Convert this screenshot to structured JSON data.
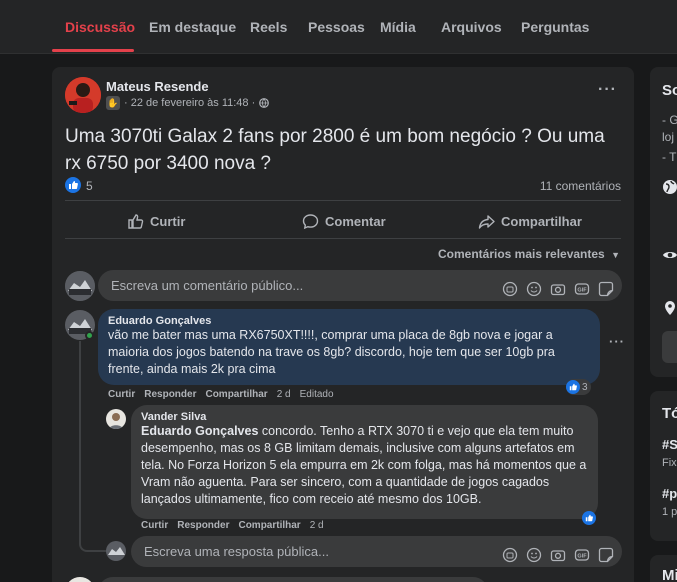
{
  "tabs": [
    {
      "label": "Discussão",
      "active": true
    },
    {
      "label": "Em destaque"
    },
    {
      "label": "Reels"
    },
    {
      "label": "Pessoas"
    },
    {
      "label": "Mídia"
    },
    {
      "label": "Arquivos"
    },
    {
      "label": "Perguntas"
    }
  ],
  "post": {
    "author": "Mateus Resende",
    "meta": "· 22 de fevereiro às 11:48 ·",
    "title": "Uma 3070ti Galax 2 fans por 2800 é um bom negócio ? Ou uma rx 6750 por 3400 nova ?",
    "like_count": "5",
    "comment_count": "11 comentários",
    "actions": {
      "like": "Curtir",
      "comment": "Comentar",
      "share": "Compartilhar"
    },
    "sort_label": "Comentários mais relevantes"
  },
  "comment_input_placeholder": "Escreva um comentário público...",
  "comments": [
    {
      "name": "Eduardo Gonçalves",
      "text": "vão me bater mas uma RX6750XT!!!!, comprar uma placa de 8gb nova e jogar a maioria dos jogos batendo na trave os 8gb? discordo, hoje tem que ser 10gb pra frente, ainda mais 2k pra cima",
      "actions": {
        "like": "Curtir",
        "reply": "Responder",
        "share": "Compartilhar",
        "time": "2 d",
        "edited": "Editado"
      },
      "reactions": "3"
    }
  ],
  "reply": {
    "name": "Vander Silva",
    "mention": "Eduardo Gonçalves",
    "text": " concordo. Tenho a RTX 3070 ti e vejo que ela tem muito desempenho, mas os 8 GB limitam demais, inclusive com alguns artefatos em tela. No Forza Horizon 5 ela empurra em 2k com folga, mas há momentos que a Vram não aguenta. Para ser sincero, com a quantidade de jogos cagados lançados ultimamente, fico com receio até mesmo dos 10GB.",
    "actions": {
      "like": "Curtir",
      "reply": "Responder",
      "share": "Compartilhar",
      "time": "2 d"
    }
  },
  "reply_input_placeholder": "Escreva uma resposta pública...",
  "sidebar": {
    "card1_title": "So",
    "card1_line1": "- G",
    "card1_line2": "loj",
    "card1_line3": "- T",
    "card2_title": "Tó",
    "card2_tag1": "#S",
    "card2_sub1": "Fix",
    "card2_tag2": "#p",
    "card2_sub2": "1 p",
    "card3_title": "Mi"
  },
  "colors": {
    "accent": "#e4414b",
    "like_blue": "#1b74e4",
    "comment_bubble_highlight": "#263951",
    "comment_bubble": "#3a3b3c"
  }
}
